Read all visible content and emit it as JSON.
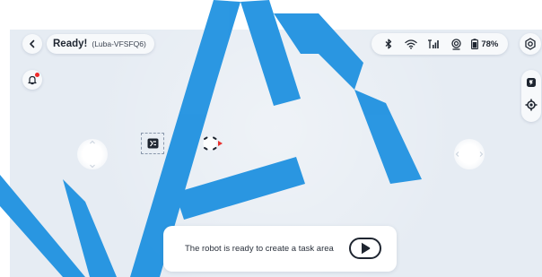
{
  "header": {
    "title": "Ready!",
    "device": "(Luba-VFSFQ6)"
  },
  "status": {
    "battery_percent": "78%",
    "icons": [
      "bluetooth-icon",
      "wifi-icon",
      "cellular-signal-icon",
      "gps-icon",
      "battery-icon"
    ]
  },
  "right_tools": {
    "icons": [
      "charging-station-icon",
      "locate-robot-icon"
    ]
  },
  "bottom": {
    "message": "The robot is ready to create a task area"
  },
  "watermark": {
    "text": "KAR"
  },
  "colors": {
    "map_background": "#e6ecf3",
    "watermark": "#1a8fe0",
    "notification_dot": "#ef2b2b",
    "robot_heading": "#e8322e",
    "text_dark": "#1e2530"
  }
}
